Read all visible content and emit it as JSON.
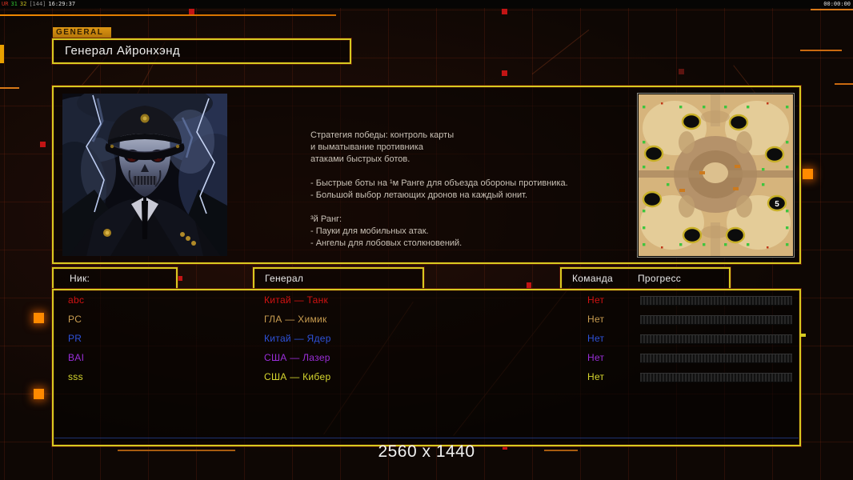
{
  "overlay": {
    "stat1": "UR",
    "stat2": "31",
    "stat3": "32",
    "stat4": "[144]",
    "clock": "16:29:37",
    "timer": "00:00:00"
  },
  "header": {
    "tab_label": "GENERAL",
    "title": "Генерал Айронхэнд"
  },
  "description": {
    "lines": [
      "Стратегия победы: контроль карты",
      "и выматывание противника",
      "атаками быстрых ботов.",
      "",
      "- Быстрые боты на ¹м Ранге для объезда обороны противника.",
      "- Большой выбор летающих дронов на каждый юнит.",
      "",
      "³й Ранг:",
      "- Пауки для мобильных атак.",
      "- Ангелы для лобовых столкновений."
    ]
  },
  "map": {
    "start_position_label": "5"
  },
  "table": {
    "headers": {
      "nick": "Ник:",
      "general": "Генерал",
      "team": "Команда",
      "progress": "Прогресс"
    }
  },
  "players": [
    {
      "nick": "abc",
      "general": "Китай — Танк",
      "team": "Нет",
      "color": "#d01212"
    },
    {
      "nick": "PC",
      "general": "ГЛА — Химик",
      "team": "Нет",
      "color": "#c89c50"
    },
    {
      "nick": "PR",
      "general": "Китай — Ядер",
      "team": "Нет",
      "color": "#2e52da"
    },
    {
      "nick": "BAI",
      "general": "США — Лазер",
      "team": "Нет",
      "color": "#9a2ed8"
    },
    {
      "nick": "sss",
      "general": "США — Кибер",
      "team": "Нет",
      "color": "#d6d62e"
    }
  ],
  "footer": {
    "resolution": "2560 x 1440"
  },
  "colors": {
    "accent_yellow": "#d6ca20",
    "accent_orange": "#e87810",
    "stat_red": "#d03020",
    "stat_green": "#30c030",
    "stat_yellow": "#c8c020",
    "stat_gray": "#909090",
    "stat_white": "#e0e0e0"
  }
}
